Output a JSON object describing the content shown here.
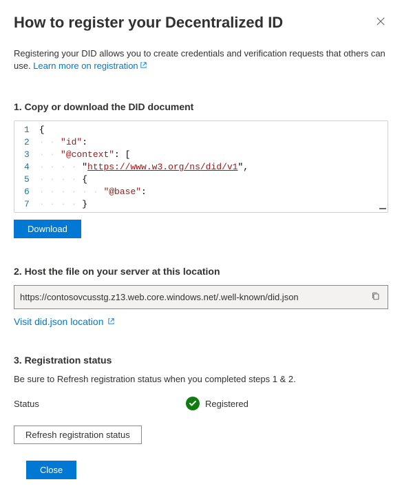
{
  "header": {
    "title": "How to register your Decentralized ID"
  },
  "description": {
    "text": "Registering your DID allows you to create credentials and verification requests that others can use. ",
    "link_text": "Learn more on registration"
  },
  "step1": {
    "heading": "1. Copy or download the DID document",
    "code_lines": [
      {
        "n": 1,
        "indent": "",
        "tokens": [
          {
            "t": "punc",
            "v": "{"
          }
        ]
      },
      {
        "n": 2,
        "indent": "· · ",
        "tokens": [
          {
            "t": "key",
            "v": "\"id\""
          },
          {
            "t": "punc",
            "v": ":"
          }
        ]
      },
      {
        "n": 3,
        "indent": "· · ",
        "tokens": [
          {
            "t": "key",
            "v": "\"@context\""
          },
          {
            "t": "punc",
            "v": ": ["
          }
        ]
      },
      {
        "n": 4,
        "indent": "· · · · ",
        "tokens": [
          {
            "t": "punc",
            "v": "\""
          },
          {
            "t": "str",
            "v": "https://www.w3.org/ns/did/v1"
          },
          {
            "t": "punc",
            "v": "\","
          }
        ]
      },
      {
        "n": 5,
        "indent": "· · · · ",
        "tokens": [
          {
            "t": "punc",
            "v": "{"
          }
        ]
      },
      {
        "n": 6,
        "indent": "· · · · · · ",
        "tokens": [
          {
            "t": "key",
            "v": "\"@base\""
          },
          {
            "t": "punc",
            "v": ":"
          }
        ]
      },
      {
        "n": 7,
        "indent": "· · · · ",
        "tokens": [
          {
            "t": "punc",
            "v": "}"
          }
        ]
      }
    ],
    "download_label": "Download"
  },
  "step2": {
    "heading": "2. Host the file on your server at this location",
    "location_value": "https://contosovcusstg.z13.web.core.windows.net/.well-known/did.json",
    "visit_link_text": "Visit did.json location"
  },
  "step3": {
    "heading": "3. Registration status",
    "instruction": "Be sure to Refresh registration status when you completed steps 1 & 2.",
    "status_label": "Status",
    "status_value": "Registered",
    "refresh_label": "Refresh registration status"
  },
  "footer": {
    "close_label": "Close"
  }
}
